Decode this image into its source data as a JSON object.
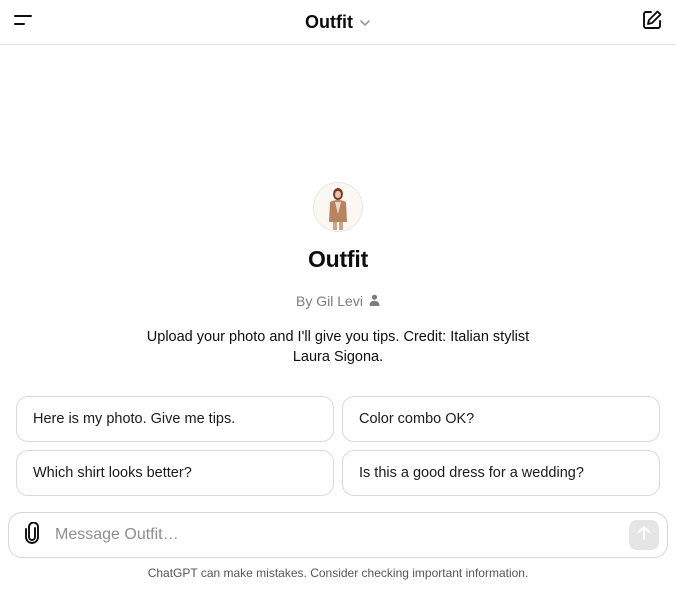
{
  "header": {
    "title": "Outfit",
    "icons": {
      "menu": "menu-icon",
      "dropdown": "chevron-down-icon",
      "new_chat": "new-chat-icon"
    }
  },
  "gpt": {
    "name": "Outfit",
    "author": "By Gil Levi",
    "author_icon": "person-icon",
    "description": "Upload your photo and I'll give you tips. Credit: Italian stylist Laura Sigona."
  },
  "suggestions": [
    {
      "label": "Here is my photo. Give me tips."
    },
    {
      "label": "Color combo OK?"
    },
    {
      "label": "Which shirt looks better?"
    },
    {
      "label": "Is this a good dress for a wedding?"
    }
  ],
  "composer": {
    "placeholder": "Message Outfit…",
    "value": "",
    "attach_icon": "paperclip-icon",
    "send_icon": "arrow-up-icon"
  },
  "footer": {
    "disclaimer": "ChatGPT can make mistakes. Consider checking important information."
  },
  "colors": {
    "text": "#0d0d0d",
    "muted": "#7d7d7d",
    "border": "#d9d9d9",
    "send_disabled": "#e5e5e5"
  }
}
